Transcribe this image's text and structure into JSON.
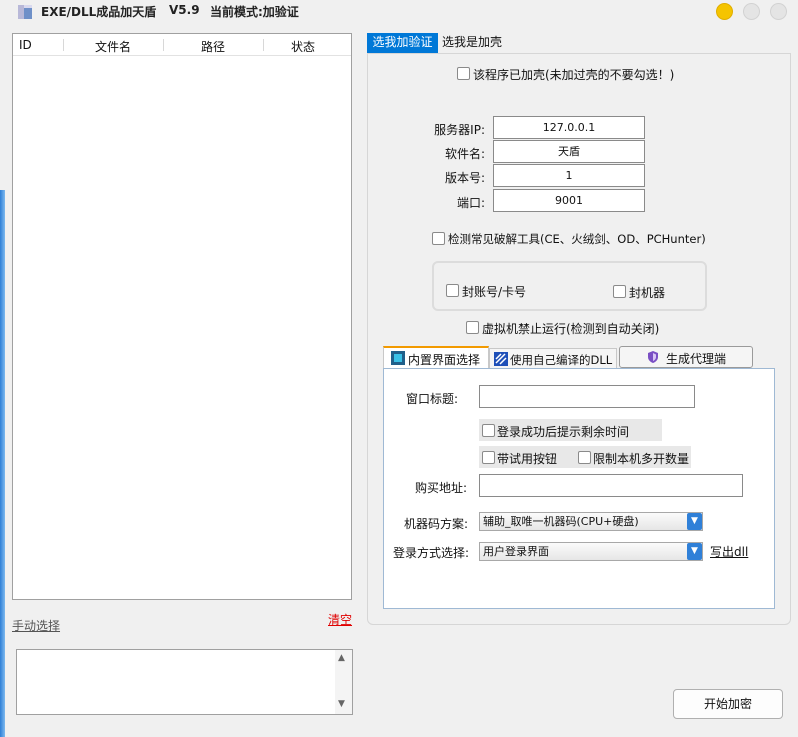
{
  "window": {
    "title": "EXE/DLL成品加天盾",
    "version": "V5.9",
    "mode": "当前模式:加验证"
  },
  "file_list": {
    "columns": [
      "ID",
      "文件名",
      "路径",
      "状态"
    ],
    "rows": []
  },
  "left_footer": {
    "manual_select": "手动选择",
    "clear": "清空"
  },
  "tabs": {
    "active": "选我加验证",
    "inactive": "选我是加壳"
  },
  "verify_panel": {
    "packed_checkbox": "该程序已加壳(未加过壳的不要勾选！)",
    "server_ip_label": "服务器IP:",
    "server_ip_value": "127.0.0.1",
    "software_name_label": "软件名:",
    "software_name_value": "天盾",
    "version_label": "版本号:",
    "version_value": "1",
    "port_label": "端口:",
    "port_value": "9001",
    "detect_crack_tools": "检测常见破解工具(CE、火绒剑、OD、PCHunter)",
    "ban_account": "封账号/卡号",
    "ban_machine": "封机器",
    "vm_block": "虚拟机禁止运行(检测到自动关闭)"
  },
  "inner_tabs": {
    "builtin_ui": "内置界面选择",
    "custom_dll": "使用自己编译的DLL",
    "generate_proxy": "生成代理端"
  },
  "ui_panel": {
    "window_title_label": "窗口标题:",
    "window_title_value": "",
    "show_remaining_time": "登录成功后提示剩余时间",
    "trial_button": "带试用按钮",
    "limit_multi_open": "限制本机多开数量",
    "buy_url_label": "购买地址:",
    "buy_url_value": "",
    "machine_code_label": "机器码方案:",
    "machine_code_value": "辅助_取唯一机器码(CPU+硬盘)",
    "login_method_label": "登录方式选择:",
    "login_method_value": "用户登录界面",
    "write_dll": "写出dll"
  },
  "start_button": "开始加密",
  "colors": {
    "tab_active_bg": "#0078d7",
    "clear_link": "#e00000",
    "dropdown_arrow": "#2f80d8",
    "min_button": "#f5c400"
  }
}
